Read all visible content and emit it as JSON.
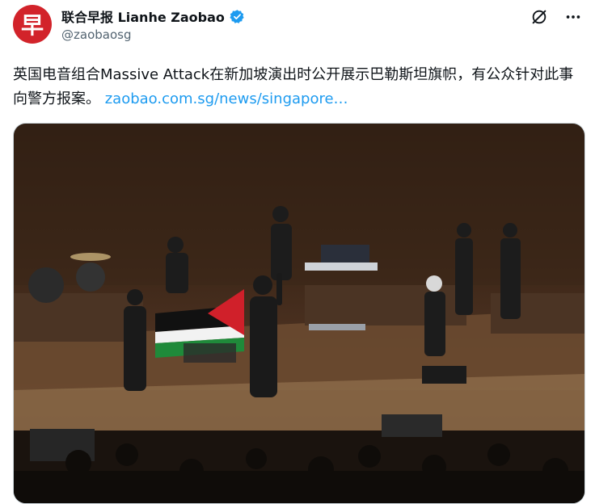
{
  "account": {
    "avatar_glyph": "早",
    "display_name": "联合早报 Lianhe Zaobao",
    "handle": "@zaobaosg",
    "verified": true,
    "brand_color": "#d2232a"
  },
  "icons": {
    "grok": "grok-icon",
    "more": "more-icon",
    "verified": "verified-badge-icon"
  },
  "tweet": {
    "text": "英国电音组合Massive Attack在新加坡演出时公开展示巴勒斯坦旗帜，有公众针对此事向警方报案。",
    "link": "zaobao.com.sg/news/singapore…",
    "link_color": "#1d9bf0"
  }
}
